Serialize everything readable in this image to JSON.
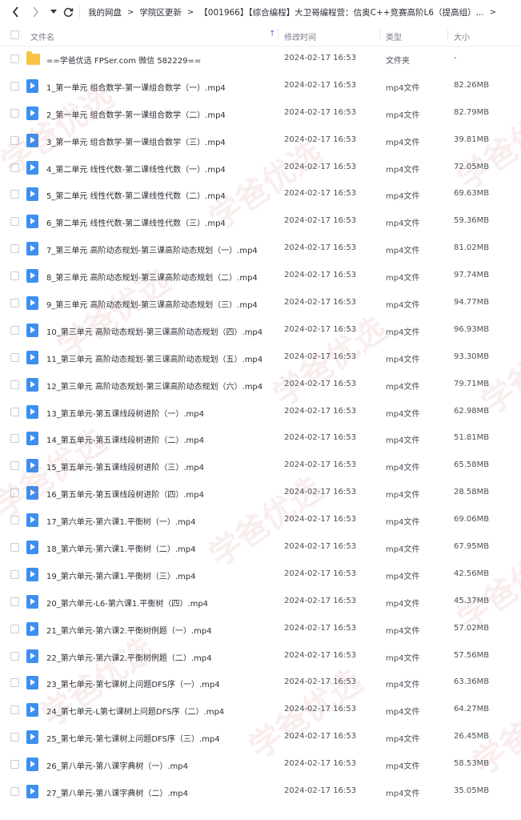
{
  "nav": {
    "back_icon": "chevron-left-icon",
    "forward_icon": "chevron-right-icon",
    "history_icon": "dropdown-caret-icon",
    "refresh_icon": "refresh-icon",
    "breadcrumb": [
      "我的网盘",
      "学院区更新",
      "【001966】【综合编程】大卫哥编程营：信奥C++竞赛高阶L6（提高组）..."
    ]
  },
  "header": {
    "name": "文件名",
    "time": "修改时间",
    "type": "类型",
    "size": "大小",
    "sort_icon": "arrow-up-icon"
  },
  "files": [
    {
      "name": "==学爸优选 FPSer.com 微信 582229==",
      "time": "2024-02-17 16:53",
      "type": "文件夹",
      "size": "-",
      "icon": "folder-icon"
    },
    {
      "name": "1_第一单元 组合数学-第一课组合数学（一）.mp4",
      "time": "2024-02-17 16:53",
      "type": "mp4文件",
      "size": "82.26MB",
      "icon": "video-icon"
    },
    {
      "name": "2_第一单元 组合数学-第一课组合数学（二）.mp4",
      "time": "2024-02-17 16:53",
      "type": "mp4文件",
      "size": "82.79MB",
      "icon": "video-icon"
    },
    {
      "name": "3_第一单元 组合数学-第一课组合数学（三）.mp4",
      "time": "2024-02-17 16:53",
      "type": "mp4文件",
      "size": "39.81MB",
      "icon": "video-icon"
    },
    {
      "name": "4_第二单元 线性代数-第二课线性代数（一）.mp4",
      "time": "2024-02-17 16:53",
      "type": "mp4文件",
      "size": "72.05MB",
      "icon": "video-icon"
    },
    {
      "name": "5_第二单元 线性代数-第二课线性代数（二）.mp4",
      "time": "2024-02-17 16:53",
      "type": "mp4文件",
      "size": "69.63MB",
      "icon": "video-icon"
    },
    {
      "name": "6_第二单元 线性代数-第二课线性代数（三）.mp4",
      "time": "2024-02-17 16:53",
      "type": "mp4文件",
      "size": "59.36MB",
      "icon": "video-icon"
    },
    {
      "name": "7_第三单元 高阶动态规划-第三课高阶动态规划（一）.mp4",
      "time": "2024-02-17 16:53",
      "type": "mp4文件",
      "size": "81.02MB",
      "icon": "video-icon"
    },
    {
      "name": "8_第三单元 高阶动态规划-第三课高阶动态规划（二）.mp4",
      "time": "2024-02-17 16:53",
      "type": "mp4文件",
      "size": "97.74MB",
      "icon": "video-icon"
    },
    {
      "name": "9_第三单元 高阶动态规划-第三课高阶动态规划（三）.mp4",
      "time": "2024-02-17 16:53",
      "type": "mp4文件",
      "size": "94.77MB",
      "icon": "video-icon"
    },
    {
      "name": "10_第三单元 高阶动态规划-第三课高阶动态规划（四）.mp4",
      "time": "2024-02-17 16:53",
      "type": "mp4文件",
      "size": "96.93MB",
      "icon": "video-icon"
    },
    {
      "name": "11_第三单元 高阶动态规划-第三课高阶动态规划（五）.mp4",
      "time": "2024-02-17 16:53",
      "type": "mp4文件",
      "size": "93.30MB",
      "icon": "video-icon"
    },
    {
      "name": "12_第三单元 高阶动态规划-第三课高阶动态规划（六）.mp4",
      "time": "2024-02-17 16:53",
      "type": "mp4文件",
      "size": "79.71MB",
      "icon": "video-icon"
    },
    {
      "name": "13_第五单元-第五课线段树进阶（一）.mp4",
      "time": "2024-02-17 16:53",
      "type": "mp4文件",
      "size": "62.98MB",
      "icon": "video-icon"
    },
    {
      "name": "14_第五单元-第五课线段树进阶（二）.mp4",
      "time": "2024-02-17 16:53",
      "type": "mp4文件",
      "size": "51.81MB",
      "icon": "video-icon"
    },
    {
      "name": "15_第五单元-第五课线段树进阶（三）.mp4",
      "time": "2024-02-17 16:53",
      "type": "mp4文件",
      "size": "65.58MB",
      "icon": "video-icon"
    },
    {
      "name": "16_第五单元-第五课线段树进阶（四）.mp4",
      "time": "2024-02-17 16:53",
      "type": "mp4文件",
      "size": "28.58MB",
      "icon": "video-icon"
    },
    {
      "name": "17_第六单元-第六课1.平衡树（一）.mp4",
      "time": "2024-02-17 16:53",
      "type": "mp4文件",
      "size": "69.06MB",
      "icon": "video-icon"
    },
    {
      "name": "18_第六单元-第六课1.平衡树（二）.mp4",
      "time": "2024-02-17 16:53",
      "type": "mp4文件",
      "size": "67.95MB",
      "icon": "video-icon"
    },
    {
      "name": "19_第六单元-第六课1.平衡树（三）.mp4",
      "time": "2024-02-17 16:53",
      "type": "mp4文件",
      "size": "42.56MB",
      "icon": "video-icon"
    },
    {
      "name": "20_第六单元-L6-第六课1.平衡树（四）.mp4",
      "time": "2024-02-17 16:53",
      "type": "mp4文件",
      "size": "45.37MB",
      "icon": "video-icon"
    },
    {
      "name": "21_第六单元-第六课2.平衡树例题（一）.mp4",
      "time": "2024-02-17 16:53",
      "type": "mp4文件",
      "size": "57.02MB",
      "icon": "video-icon"
    },
    {
      "name": "22_第六单元-第六课2.平衡树例题（二）.mp4",
      "time": "2024-02-17 16:53",
      "type": "mp4文件",
      "size": "57.56MB",
      "icon": "video-icon"
    },
    {
      "name": "23_第七单元-第七课树上问题DFS序（一）.mp4",
      "time": "2024-02-17 16:53",
      "type": "mp4文件",
      "size": "63.36MB",
      "icon": "video-icon"
    },
    {
      "name": "24_第七单元-L第七课树上问题DFS序（二）.mp4",
      "time": "2024-02-17 16:53",
      "type": "mp4文件",
      "size": "64.27MB",
      "icon": "video-icon"
    },
    {
      "name": "25_第七单元-第七课树上问题DFS序（三）.mp4",
      "time": "2024-02-17 16:53",
      "type": "mp4文件",
      "size": "26.45MB",
      "icon": "video-icon"
    },
    {
      "name": "26_第八单元-第八课字典树（一）.mp4",
      "time": "2024-02-17 16:53",
      "type": "mp4文件",
      "size": "58.53MB",
      "icon": "video-icon"
    },
    {
      "name": "27_第八单元-第八课字典树（二）.mp4",
      "time": "2024-02-17 16:53",
      "type": "mp4文件",
      "size": "35.05MB",
      "icon": "video-icon"
    }
  ],
  "watermark": "学爸优选"
}
